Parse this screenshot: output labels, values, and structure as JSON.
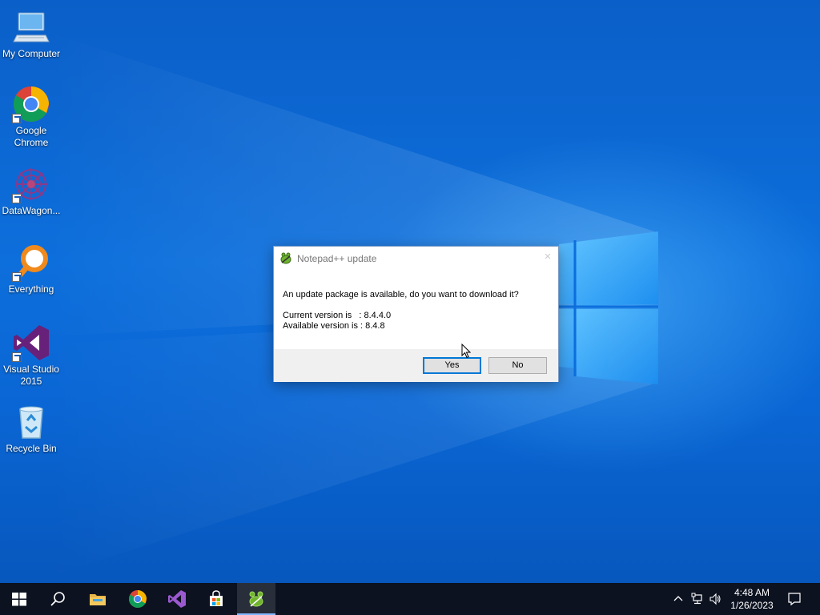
{
  "desktop": {
    "icons": [
      {
        "label": "My Computer",
        "icon": "computer-icon",
        "shortcut": false
      },
      {
        "label": "Google Chrome",
        "icon": "chrome-icon",
        "shortcut": true
      },
      {
        "label": "DataWagon...",
        "icon": "datawagon-icon",
        "shortcut": true
      },
      {
        "label": "Everything",
        "icon": "everything-search-icon",
        "shortcut": true
      },
      {
        "label": "Visual Studio 2015",
        "icon": "visual-studio-icon",
        "shortcut": true
      },
      {
        "label": "Recycle Bin",
        "icon": "recycle-bin-icon",
        "shortcut": false
      }
    ]
  },
  "dialog": {
    "title": "Notepad++ update",
    "message": "An update package is available, do you want to download it?",
    "current_version": "Current version is   : 8.4.4.0",
    "available_version": "Available version is : 8.4.8",
    "yes_label": "Yes",
    "no_label": "No"
  },
  "taskbar": {
    "apps": [
      {
        "name": "start-button",
        "icon": "windows-logo-icon"
      },
      {
        "name": "search-button",
        "icon": "search-icon"
      },
      {
        "name": "file-explorer-button",
        "icon": "folder-icon"
      },
      {
        "name": "chrome-taskbar-button",
        "icon": "chrome-icon"
      },
      {
        "name": "visual-studio-taskbar-button",
        "icon": "visual-studio-icon"
      },
      {
        "name": "store-taskbar-button",
        "icon": "store-icon"
      },
      {
        "name": "notepadpp-taskbar-button",
        "icon": "notepadpp-icon",
        "active": true
      }
    ],
    "clock": {
      "time": "4:48 AM",
      "date": "1/26/2023"
    }
  },
  "colors": {
    "desktop": "#0a63cc",
    "taskbar": "#0c1220",
    "accent": "#0078d7"
  }
}
